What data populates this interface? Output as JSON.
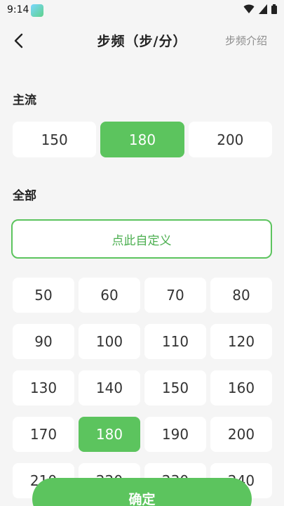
{
  "status": {
    "time": "9:14"
  },
  "header": {
    "title": "步频（步/分）",
    "intro_link": "步频介绍"
  },
  "sections": {
    "main_label": "主流",
    "all_label": "全部"
  },
  "main_options": [
    {
      "label": "150",
      "selected": false
    },
    {
      "label": "180",
      "selected": true
    },
    {
      "label": "200",
      "selected": false
    }
  ],
  "custom_button": "点此自定义",
  "all_options": [
    {
      "label": "50",
      "selected": false
    },
    {
      "label": "60",
      "selected": false
    },
    {
      "label": "70",
      "selected": false
    },
    {
      "label": "80",
      "selected": false
    },
    {
      "label": "90",
      "selected": false
    },
    {
      "label": "100",
      "selected": false
    },
    {
      "label": "110",
      "selected": false
    },
    {
      "label": "120",
      "selected": false
    },
    {
      "label": "130",
      "selected": false
    },
    {
      "label": "140",
      "selected": false
    },
    {
      "label": "150",
      "selected": false
    },
    {
      "label": "160",
      "selected": false
    },
    {
      "label": "170",
      "selected": false
    },
    {
      "label": "180",
      "selected": true
    },
    {
      "label": "190",
      "selected": false
    },
    {
      "label": "200",
      "selected": false
    },
    {
      "label": "210",
      "selected": false
    },
    {
      "label": "220",
      "selected": false
    },
    {
      "label": "230",
      "selected": false
    },
    {
      "label": "240",
      "selected": false
    }
  ],
  "confirm_button": "确定",
  "colors": {
    "accent": "#5cc45e",
    "background": "#f5f5f5",
    "muted_text": "#8c8c8c"
  }
}
